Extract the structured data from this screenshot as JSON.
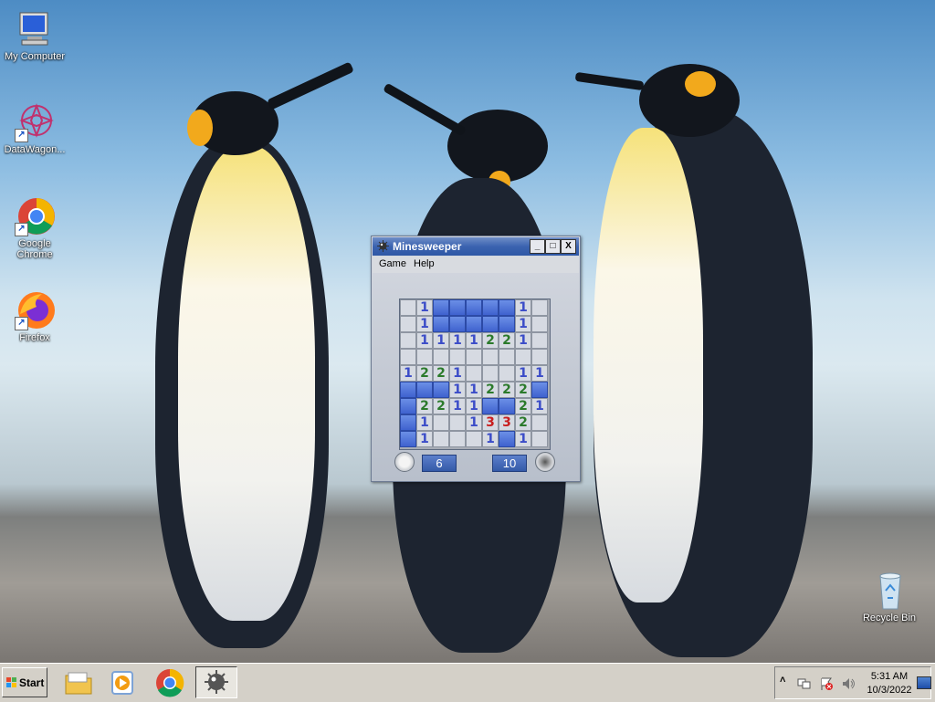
{
  "desktop": {
    "icons": [
      {
        "label": "My Computer"
      },
      {
        "label": "DataWagon..."
      },
      {
        "label": "Google Chrome"
      },
      {
        "label": "Firefox"
      },
      {
        "label": "Recycle Bin"
      }
    ]
  },
  "window": {
    "title": "Minesweeper",
    "menu": [
      "Game",
      "Help"
    ],
    "title_buttons": [
      "_",
      "□",
      "X"
    ],
    "timer_value": "6",
    "mines_value": "10",
    "board": [
      [
        "o",
        "1",
        "c",
        "c",
        "c",
        "c",
        "c",
        "1",
        "o"
      ],
      [
        "o",
        "1",
        "c",
        "c",
        "c",
        "c",
        "c",
        "1",
        "o"
      ],
      [
        "o",
        "1",
        "1",
        "1",
        "1",
        "2",
        "2",
        "1",
        "o"
      ],
      [
        "o",
        "o",
        "o",
        "o",
        "o",
        "o",
        "o",
        "o",
        "o"
      ],
      [
        "1",
        "2",
        "2",
        "1",
        "o",
        "o",
        "o",
        "1",
        "1"
      ],
      [
        "c",
        "c",
        "c",
        "1",
        "1",
        "2",
        "2",
        "2",
        "c"
      ],
      [
        "c",
        "2",
        "2",
        "1",
        "1",
        "c",
        "c",
        "2",
        "1"
      ],
      [
        "c",
        "1",
        "o",
        "o",
        "1",
        "3",
        "3",
        "2",
        "o"
      ],
      [
        "c",
        "1",
        "o",
        "o",
        "o",
        "1",
        "c",
        "1",
        "o"
      ]
    ]
  },
  "taskbar": {
    "start_label": "Start",
    "apps": [
      "file-explorer-icon",
      "media-player-icon",
      "chrome-icon",
      "minesweeper-icon"
    ],
    "tray": {
      "time": "5:31 AM",
      "date": "10/3/2022"
    }
  }
}
